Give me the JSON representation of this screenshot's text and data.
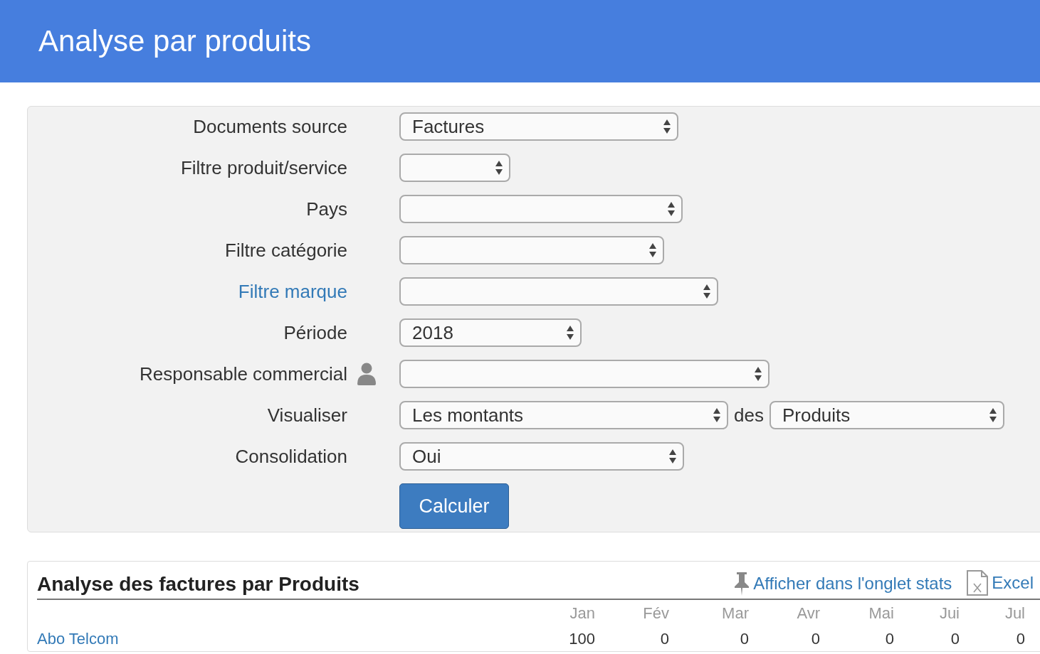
{
  "header": {
    "title": "Analyse par produits"
  },
  "form": {
    "rows": [
      {
        "label": "Documents source",
        "kind": "plain",
        "value": "Factures"
      },
      {
        "label": "Filtre produit/service",
        "kind": "plain",
        "value": ""
      },
      {
        "label": "Pays",
        "kind": "plain",
        "value": ""
      },
      {
        "label": "Filtre catégorie",
        "kind": "plain",
        "value": ""
      },
      {
        "label": "Filtre marque",
        "kind": "link",
        "value": ""
      },
      {
        "label": "Période",
        "kind": "plain",
        "value": "2018"
      },
      {
        "label": "Responsable commercial",
        "kind": "user",
        "value": ""
      },
      {
        "label": "Visualiser",
        "kind": "plain",
        "value": "Les montants",
        "extra": {
          "text": "des",
          "value": "Produits"
        }
      },
      {
        "label": "Consolidation",
        "kind": "plain",
        "value": "Oui"
      }
    ],
    "button": "Calculer"
  },
  "report": {
    "title": "Analyse des factures par Produits",
    "actions": [
      {
        "kind": "pin",
        "label": "Afficher dans l'onglet stats"
      },
      {
        "kind": "excel",
        "label": "Excel"
      }
    ],
    "table": {
      "columns": [
        "Jan",
        "Fév",
        "Mar",
        "Avr",
        "Mai",
        "Jui",
        "Jul"
      ],
      "rows": [
        {
          "name": "Abo Telcom",
          "values": [
            "100",
            "0",
            "0",
            "0",
            "0",
            "0",
            "0"
          ]
        }
      ]
    }
  }
}
